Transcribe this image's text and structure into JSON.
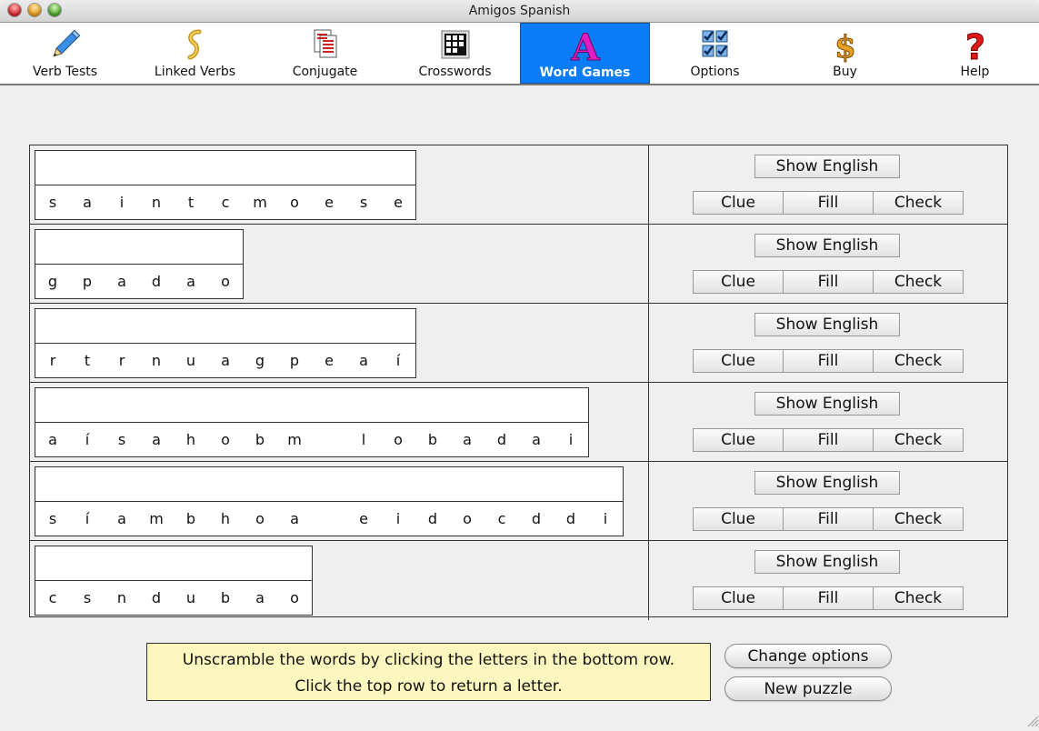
{
  "window": {
    "title": "Amigos Spanish"
  },
  "toolbar": {
    "items": [
      {
        "label": "Verb Tests",
        "icon": "pencil-icon",
        "active": false
      },
      {
        "label": "Linked Verbs",
        "icon": "chain-link-icon",
        "active": false
      },
      {
        "label": "Conjugate",
        "icon": "documents-icon",
        "active": false
      },
      {
        "label": "Crosswords",
        "icon": "crossword-grid-icon",
        "active": false
      },
      {
        "label": "Word Games",
        "icon": "letter-a-icon",
        "active": true
      },
      {
        "label": "Options",
        "icon": "checkboxes-icon",
        "active": false
      },
      {
        "label": "Buy",
        "icon": "dollar-sign-icon",
        "active": false
      },
      {
        "label": "Help",
        "icon": "question-mark-icon",
        "active": false
      }
    ],
    "accent_color": "#0b7cf8"
  },
  "puzzles": [
    {
      "top": [
        "",
        "",
        "",
        "",
        "",
        "",
        "",
        "",
        "",
        "",
        ""
      ],
      "bottom": [
        "s",
        "a",
        "i",
        "n",
        "t",
        "c",
        "m",
        "o",
        "e",
        "s",
        "e"
      ]
    },
    {
      "top": [
        "",
        "",
        "",
        "",
        "",
        ""
      ],
      "bottom": [
        "g",
        "p",
        "a",
        "d",
        "a",
        "o"
      ]
    },
    {
      "top": [
        "",
        "",
        "",
        "",
        "",
        "",
        "",
        "",
        "",
        "",
        ""
      ],
      "bottom": [
        "r",
        "t",
        "r",
        "n",
        "u",
        "a",
        "g",
        "p",
        "e",
        "a",
        "í"
      ]
    },
    {
      "top": [
        "",
        "",
        "",
        "",
        "",
        "",
        "",
        "",
        "",
        "",
        "",
        "",
        "",
        "",
        "",
        ""
      ],
      "bottom": [
        "a",
        "í",
        "s",
        "a",
        "h",
        "o",
        "b",
        "m",
        " ",
        "l",
        "o",
        "b",
        "a",
        "d",
        "a",
        "i"
      ]
    },
    {
      "top": [
        "",
        "",
        "",
        "",
        "",
        "",
        "",
        "",
        "",
        "",
        "",
        "",
        "",
        "",
        "",
        "",
        ""
      ],
      "bottom": [
        "s",
        "í",
        "a",
        "m",
        "b",
        "h",
        "o",
        "a",
        " ",
        "e",
        "i",
        "d",
        "o",
        "c",
        "d",
        "d",
        "i"
      ]
    },
    {
      "top": [
        "",
        "",
        "",
        "",
        "",
        "",
        "",
        ""
      ],
      "bottom": [
        "c",
        "s",
        "n",
        "d",
        "u",
        "b",
        "a",
        "o"
      ]
    }
  ],
  "row_controls": {
    "show_english": "Show English",
    "clue": "Clue",
    "fill": "Fill",
    "check": "Check"
  },
  "hint": {
    "line1": "Unscramble the words by clicking the letters in the bottom row.",
    "line2": "Click the top row to return a letter.",
    "background": "#fcf7bf"
  },
  "actions": {
    "change_options": "Change options",
    "new_puzzle": "New puzzle"
  }
}
